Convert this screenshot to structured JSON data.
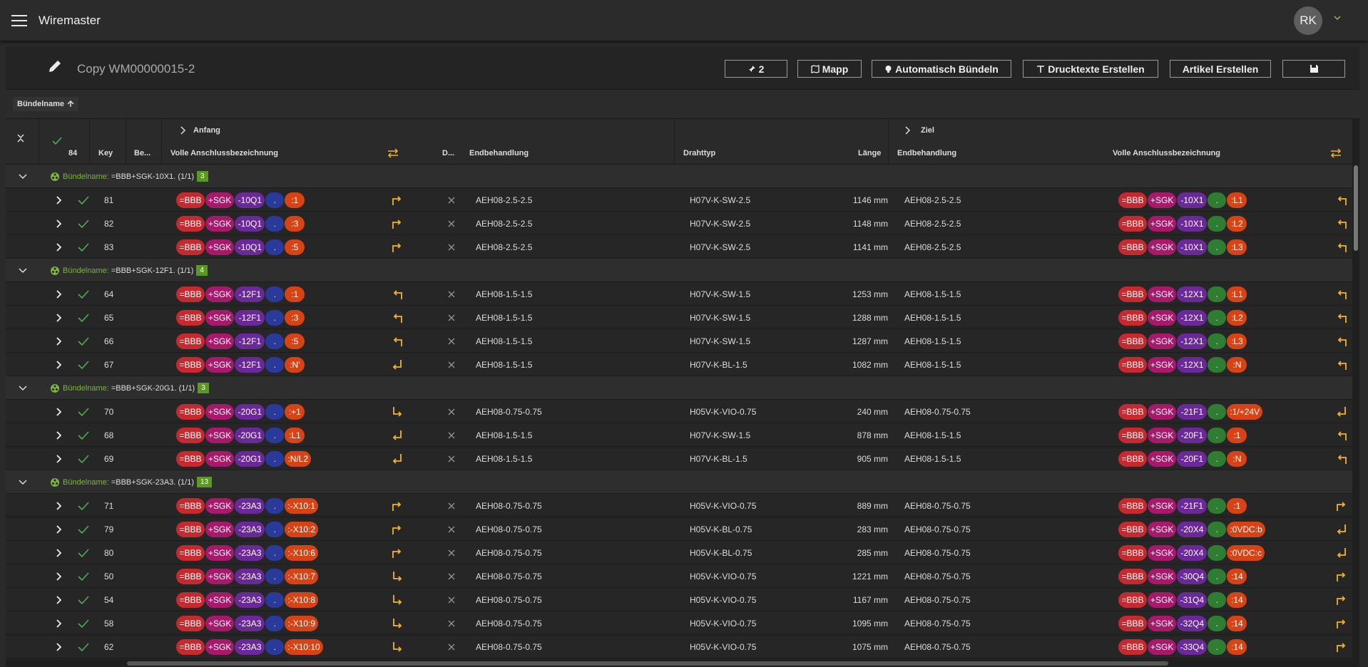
{
  "app": {
    "title": "Wiremaster",
    "avatar": "RK"
  },
  "header": {
    "doc_title": "Copy WM00000015-2"
  },
  "toolbar": [
    {
      "icon": "pin-icon",
      "label": "2"
    },
    {
      "icon": "map-icon",
      "label": "Mapp"
    },
    {
      "icon": "bulb-icon",
      "label": "Automatisch Bündeln"
    },
    {
      "icon": "text-icon",
      "label": "Drucktexte Erstellen"
    },
    {
      "icon": "",
      "label": "Artikel Erstellen"
    },
    {
      "icon": "save-icon",
      "label": ""
    }
  ],
  "sort": {
    "label": "Bündelname"
  },
  "grid": {
    "group_headers": {
      "anfang": "Anfang",
      "ziel": "Ziel"
    },
    "columns": {
      "count": "84",
      "key": "Key",
      "be": "Be...",
      "volle_a": "Volle Anschlussbezeichnung",
      "d": "D...",
      "endbeh_a": "Endbehandlung",
      "drahttyp": "Drahttyp",
      "laenge": "Länge",
      "endbeh_z": "Endbehandlung",
      "volle_z": "Volle Anschlussbezeichnung"
    },
    "bundle_prefix": "Bündelname:",
    "bundles": [
      {
        "name": "=BBB+SGK-10X1. (1/1)",
        "count": "3",
        "rows": [
          {
            "key": "81",
            "a": [
              "=BBB",
              "+SGK",
              "-10Q1",
              ".",
              ":1"
            ],
            "adir": "turn-right",
            "end_a": "AEH08-2.5-2.5",
            "typ": "H07V-K-SW-2.5",
            "len": "1146 mm",
            "end_z": "AEH08-2.5-2.5",
            "z": [
              "=BBB",
              "+SGK",
              "-10X1",
              ".",
              ":L1"
            ],
            "zdir": "turn-left"
          },
          {
            "key": "82",
            "a": [
              "=BBB",
              "+SGK",
              "-10Q1",
              ".",
              ":3"
            ],
            "adir": "turn-right",
            "end_a": "AEH08-2.5-2.5",
            "typ": "H07V-K-SW-2.5",
            "len": "1148 mm",
            "end_z": "AEH08-2.5-2.5",
            "z": [
              "=BBB",
              "+SGK",
              "-10X1",
              ".",
              ":L2"
            ],
            "zdir": "turn-left"
          },
          {
            "key": "83",
            "a": [
              "=BBB",
              "+SGK",
              "-10Q1",
              ".",
              ":5"
            ],
            "adir": "turn-right",
            "end_a": "AEH08-2.5-2.5",
            "typ": "H07V-K-SW-2.5",
            "len": "1141 mm",
            "end_z": "AEH08-2.5-2.5",
            "z": [
              "=BBB",
              "+SGK",
              "-10X1",
              ".",
              ":L3"
            ],
            "zdir": "turn-left"
          }
        ]
      },
      {
        "name": "=BBB+SGK-12F1. (1/1)",
        "count": "4",
        "rows": [
          {
            "key": "64",
            "a": [
              "=BBB",
              "+SGK",
              "-12F1",
              ".",
              ":1"
            ],
            "adir": "turn-left",
            "end_a": "AEH08-1.5-1.5",
            "typ": "H07V-K-SW-1.5",
            "len": "1253 mm",
            "end_z": "AEH08-1.5-1.5",
            "z": [
              "=BBB",
              "+SGK",
              "-12X1",
              ".",
              ":L1"
            ],
            "zdir": "turn-left"
          },
          {
            "key": "65",
            "a": [
              "=BBB",
              "+SGK",
              "-12F1",
              ".",
              ":3"
            ],
            "adir": "turn-left",
            "end_a": "AEH08-1.5-1.5",
            "typ": "H07V-K-SW-1.5",
            "len": "1288 mm",
            "end_z": "AEH08-1.5-1.5",
            "z": [
              "=BBB",
              "+SGK",
              "-12X1",
              ".",
              ":L2"
            ],
            "zdir": "turn-left"
          },
          {
            "key": "66",
            "a": [
              "=BBB",
              "+SGK",
              "-12F1",
              ".",
              ":5"
            ],
            "adir": "turn-left",
            "end_a": "AEH08-1.5-1.5",
            "typ": "H07V-K-SW-1.5",
            "len": "1287 mm",
            "end_z": "AEH08-1.5-1.5",
            "z": [
              "=BBB",
              "+SGK",
              "-12X1",
              ".",
              ":L3"
            ],
            "zdir": "turn-left"
          },
          {
            "key": "67",
            "a": [
              "=BBB",
              "+SGK",
              "-12F1",
              ".",
              ":N'"
            ],
            "adir": "return",
            "end_a": "AEH08-1.5-1.5",
            "typ": "H07V-K-BL-1.5",
            "len": "1082 mm",
            "end_z": "AEH08-1.5-1.5",
            "z": [
              "=BBB",
              "+SGK",
              "-12X1",
              ".",
              ":N"
            ],
            "zdir": "turn-left"
          }
        ]
      },
      {
        "name": "=BBB+SGK-20G1. (1/1)",
        "count": "3",
        "rows": [
          {
            "key": "70",
            "a": [
              "=BBB",
              "+SGK",
              "-20G1",
              ".",
              ":+1"
            ],
            "adir": "down-right",
            "end_a": "AEH08-0.75-0.75",
            "typ": "H05V-K-VIO-0.75",
            "len": "240 mm",
            "end_z": "AEH08-0.75-0.75",
            "z": [
              "=BBB",
              "+SGK",
              "-21F1",
              ".",
              ":1/+24V"
            ],
            "zdir": "return"
          },
          {
            "key": "68",
            "a": [
              "=BBB",
              "+SGK",
              "-20G1",
              ".",
              ":L1"
            ],
            "adir": "return",
            "end_a": "AEH08-1.5-1.5",
            "typ": "H07V-K-SW-1.5",
            "len": "878 mm",
            "end_z": "AEH08-1.5-1.5",
            "z": [
              "=BBB",
              "+SGK",
              "-20F1",
              ".",
              ":1"
            ],
            "zdir": "turn-left"
          },
          {
            "key": "69",
            "a": [
              "=BBB",
              "+SGK",
              "-20G1",
              ".",
              ":N/L2"
            ],
            "adir": "return",
            "end_a": "AEH08-1.5-1.5",
            "typ": "H07V-K-BL-1.5",
            "len": "905 mm",
            "end_z": "AEH08-1.5-1.5",
            "z": [
              "=BBB",
              "+SGK",
              "-20F1",
              ".",
              ":N"
            ],
            "zdir": "turn-left"
          }
        ]
      },
      {
        "name": "=BBB+SGK-23A3. (1/1)",
        "count": "13",
        "rows": [
          {
            "key": "71",
            "a": [
              "=BBB",
              "+SGK",
              "-23A3",
              ".",
              ":-X10:1"
            ],
            "adir": "turn-right",
            "end_a": "AEH08-0.75-0.75",
            "typ": "H05V-K-VIO-0.75",
            "len": "889 mm",
            "end_z": "AEH08-0.75-0.75",
            "z": [
              "=BBB",
              "+SGK",
              "-21F1",
              ".",
              ":1"
            ],
            "zdir": "turn-right"
          },
          {
            "key": "79",
            "a": [
              "=BBB",
              "+SGK",
              "-23A3",
              ".",
              ":-X10:2"
            ],
            "adir": "turn-right",
            "end_a": "AEH08-0.75-0.75",
            "typ": "H05V-K-BL-0.75",
            "len": "283 mm",
            "end_z": "AEH08-0.75-0.75",
            "z": [
              "=BBB",
              "+SGK",
              "-20X4",
              ".",
              ":0VDC:b"
            ],
            "zdir": "return"
          },
          {
            "key": "80",
            "a": [
              "=BBB",
              "+SGK",
              "-23A3",
              ".",
              ":-X10:6"
            ],
            "adir": "turn-right",
            "end_a": "AEH08-0.75-0.75",
            "typ": "H05V-K-BL-0.75",
            "len": "285 mm",
            "end_z": "AEH08-0.75-0.75",
            "z": [
              "=BBB",
              "+SGK",
              "-20X4",
              ".",
              ":0VDC:c"
            ],
            "zdir": "return"
          },
          {
            "key": "50",
            "a": [
              "=BBB",
              "+SGK",
              "-23A3",
              ".",
              ":-X10:7"
            ],
            "adir": "down-right",
            "end_a": "AEH08-0.75-0.75",
            "typ": "H05V-K-VIO-0.75",
            "len": "1221 mm",
            "end_z": "AEH08-0.75-0.75",
            "z": [
              "=BBB",
              "+SGK",
              "-30Q4",
              ".",
              ":14"
            ],
            "zdir": "turn-right"
          },
          {
            "key": "54",
            "a": [
              "=BBB",
              "+SGK",
              "-23A3",
              ".",
              ":-X10:8"
            ],
            "adir": "down-right",
            "end_a": "AEH08-0.75-0.75",
            "typ": "H05V-K-VIO-0.75",
            "len": "1167 mm",
            "end_z": "AEH08-0.75-0.75",
            "z": [
              "=BBB",
              "+SGK",
              "-31Q4",
              ".",
              ":14"
            ],
            "zdir": "turn-right"
          },
          {
            "key": "58",
            "a": [
              "=BBB",
              "+SGK",
              "-23A3",
              ".",
              ":-X10:9"
            ],
            "adir": "down-right",
            "end_a": "AEH08-0.75-0.75",
            "typ": "H05V-K-VIO-0.75",
            "len": "1095 mm",
            "end_z": "AEH08-0.75-0.75",
            "z": [
              "=BBB",
              "+SGK",
              "-32Q4",
              ".",
              ":14"
            ],
            "zdir": "turn-right"
          },
          {
            "key": "62",
            "a": [
              "=BBB",
              "+SGK",
              "-23A3",
              ".",
              ":-X10:10"
            ],
            "adir": "down-right",
            "end_a": "AEH08-0.75-0.75",
            "typ": "H05V-K-VIO-0.75",
            "len": "1075 mm",
            "end_z": "AEH08-0.75-0.75",
            "z": [
              "=BBB",
              "+SGK",
              "-33Q4",
              ".",
              ":14"
            ],
            "zdir": "turn-right"
          }
        ]
      }
    ]
  },
  "colors": {
    "accent": "#f5b324",
    "check": "#4caf50",
    "group_name": "#7cb342"
  }
}
